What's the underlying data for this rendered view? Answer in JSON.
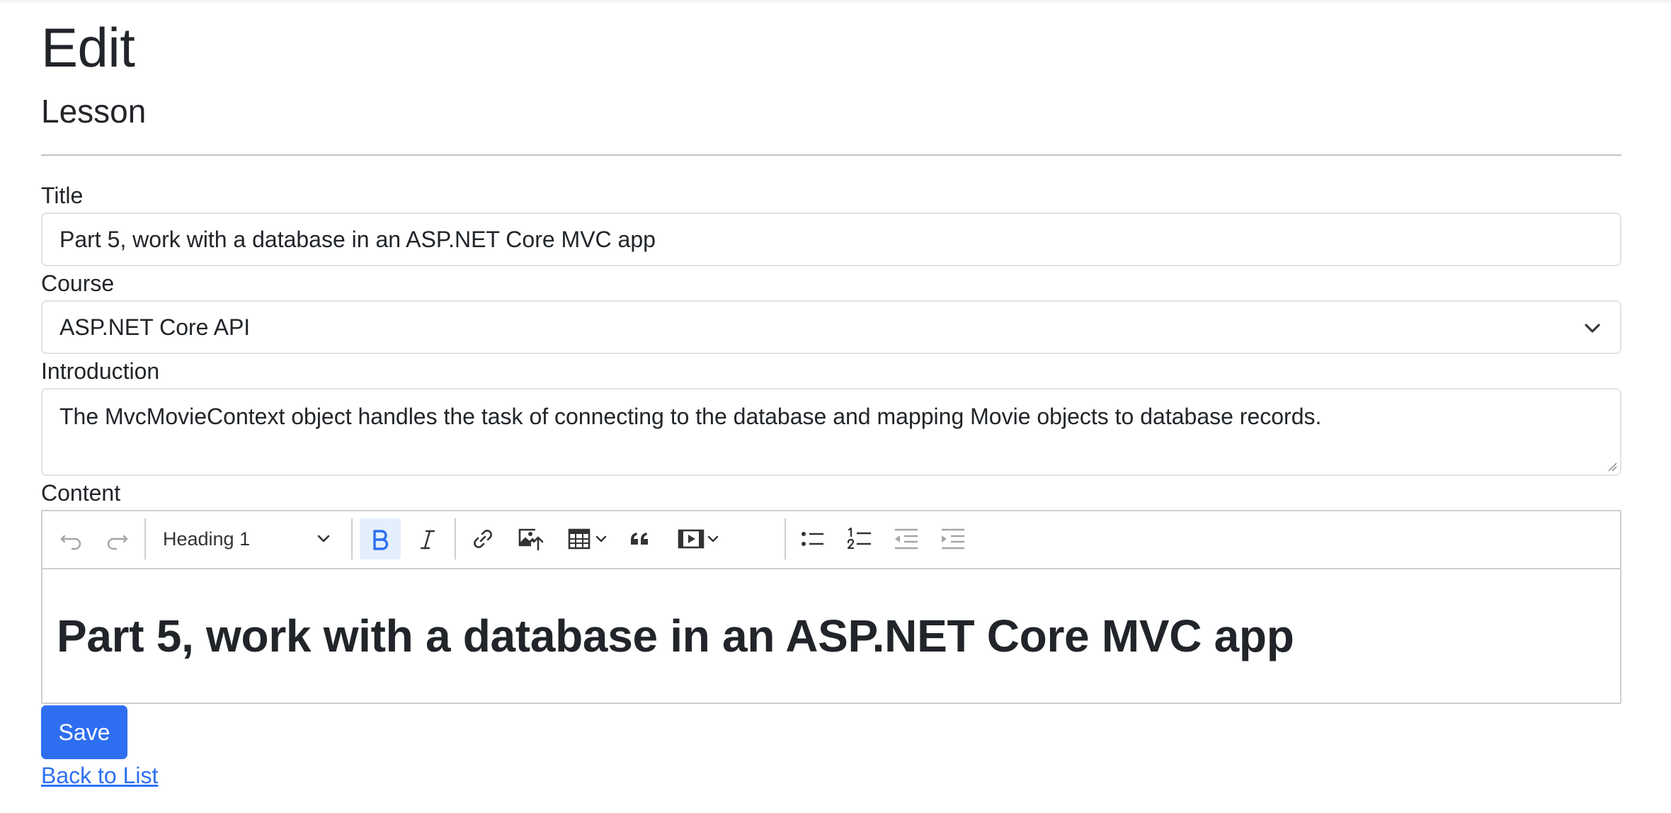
{
  "page": {
    "title": "Edit",
    "subtitle": "Lesson"
  },
  "form": {
    "title_label": "Title",
    "title_value": "Part 5, work with a database in an ASP.NET Core MVC app",
    "course_label": "Course",
    "course_value": "ASP.NET Core API",
    "introduction_label": "Introduction",
    "introduction_value": "The MvcMovieContext object handles the task of connecting to the database and mapping Movie objects to database records.",
    "content_label": "Content"
  },
  "editor": {
    "heading_style": "Heading 1",
    "content_heading": "Part 5, work with a database in an ASP.NET Core MVC app",
    "active_format": "bold"
  },
  "actions": {
    "save_label": "Save",
    "back_link": "Back to List"
  },
  "colors": {
    "primary": "#2e6ff2",
    "active_toolbar_bg": "#e4effc",
    "border": "#dee2e6"
  },
  "icons": {
    "toolbar": [
      "undo-icon",
      "redo-icon",
      "bold-icon",
      "italic-icon",
      "link-icon",
      "image-upload-icon",
      "table-icon",
      "blockquote-icon",
      "media-icon",
      "bulleted-list-icon",
      "numbered-list-icon",
      "outdent-icon",
      "indent-icon"
    ]
  }
}
